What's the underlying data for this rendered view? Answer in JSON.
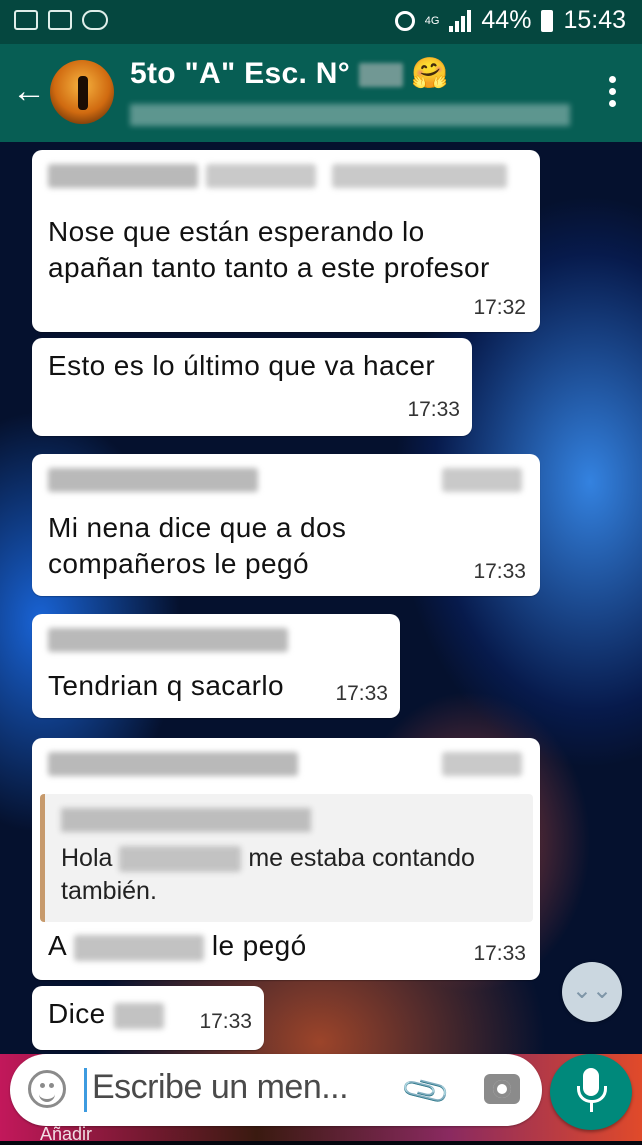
{
  "status_bar": {
    "network": "4G",
    "battery": "44%",
    "time": "15:43"
  },
  "header": {
    "group_name": "5to \"A\" Esc. N°",
    "emoji": "🤗"
  },
  "messages": [
    {
      "text_lines": [
        "Nose que están esperando lo",
        "apañan tanto tanto a este profesor"
      ],
      "time": "17:32"
    },
    {
      "text_lines": [
        "Esto es lo último que va hacer"
      ],
      "time": "17:33"
    },
    {
      "text_lines": [
        "Mi nena dice que a dos",
        "compañeros le pegó"
      ],
      "time": "17:33"
    },
    {
      "text_lines": [
        "Tendrian q sacarlo"
      ],
      "time": "17:33"
    },
    {
      "quote": {
        "before": "Hola",
        "after": "me estaba contando",
        "line2": "también."
      },
      "text_before": "A",
      "text_after": "le pegó",
      "time": "17:33"
    },
    {
      "text_before": "Dice",
      "time": "17:33"
    }
  ],
  "input": {
    "placeholder": "Escribe un men..."
  },
  "attachment_label": "Añadir",
  "icons": {
    "back": "arrow-left-icon",
    "menu": "more-vertical-icon",
    "emoji": "emoji-icon",
    "attach": "paperclip-icon",
    "camera": "camera-icon",
    "mic": "microphone-icon",
    "scroll": "chevron-double-down-icon"
  },
  "colors": {
    "header": "#075e54",
    "status_bar": "#05473f",
    "mic_button": "#00897b",
    "bubble": "#ffffff"
  }
}
